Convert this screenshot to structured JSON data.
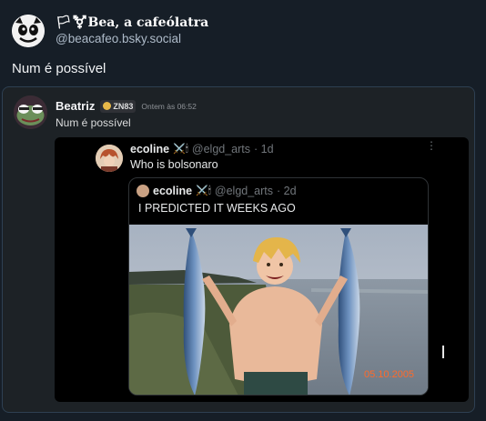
{
  "post": {
    "display_name": "🏳⚧Bea, a cafeólatra",
    "handle": "@beacafeo.bsky.social",
    "text": "Num é possível"
  },
  "discord": {
    "author": "Beatriz",
    "tag": "ZN83",
    "timestamp": "Ontem às 06:52",
    "message": "Num é possível"
  },
  "tweet": {
    "name": "ecoline",
    "name_emoji": "⚔️🕯",
    "handle": "@elgd_arts",
    "time": "· 1d",
    "text": "Who is bolsonaro",
    "more": "⋮",
    "quoted": {
      "name": "ecoline",
      "name_emoji": "⚔️🕯",
      "handle": "@elgd_arts",
      "time": "· 2d",
      "text": "I PREDICTED IT WEEKS AGO",
      "image_date_stamp": "05.10.2005"
    }
  },
  "colors": {
    "page_bg": "#161e27",
    "card_border": "#2e4052",
    "discord_bg": "#1d2226",
    "date_stamp": "#ff6a2a"
  }
}
